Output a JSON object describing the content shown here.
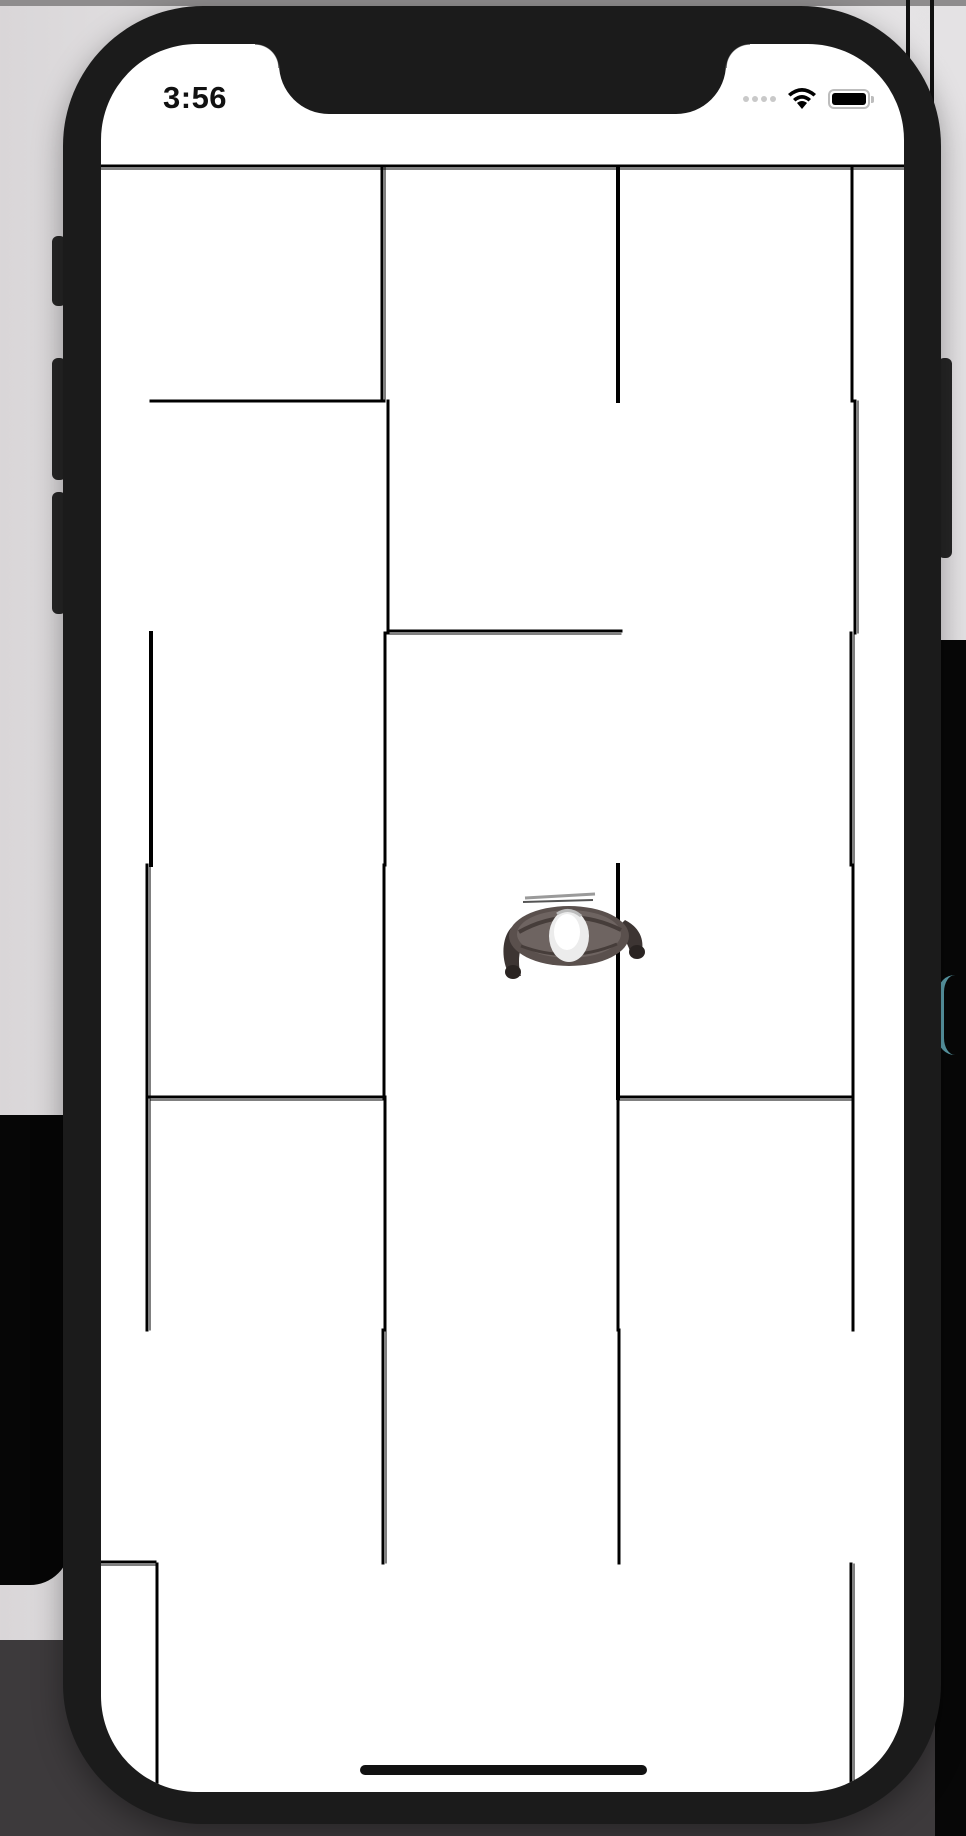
{
  "status_bar": {
    "time": "3:56",
    "wifi_icon": "wifi-icon",
    "battery_icon": "battery-icon",
    "signal_icon": "cellular-signal-icon"
  },
  "game": {
    "type": "maze",
    "player_icon": "player-character-icon",
    "wall_color": "#000000",
    "floor_color": "#ffffff"
  },
  "colors": {
    "device_frame": "#1b1b1b",
    "screen_bg": "#ffffff"
  }
}
